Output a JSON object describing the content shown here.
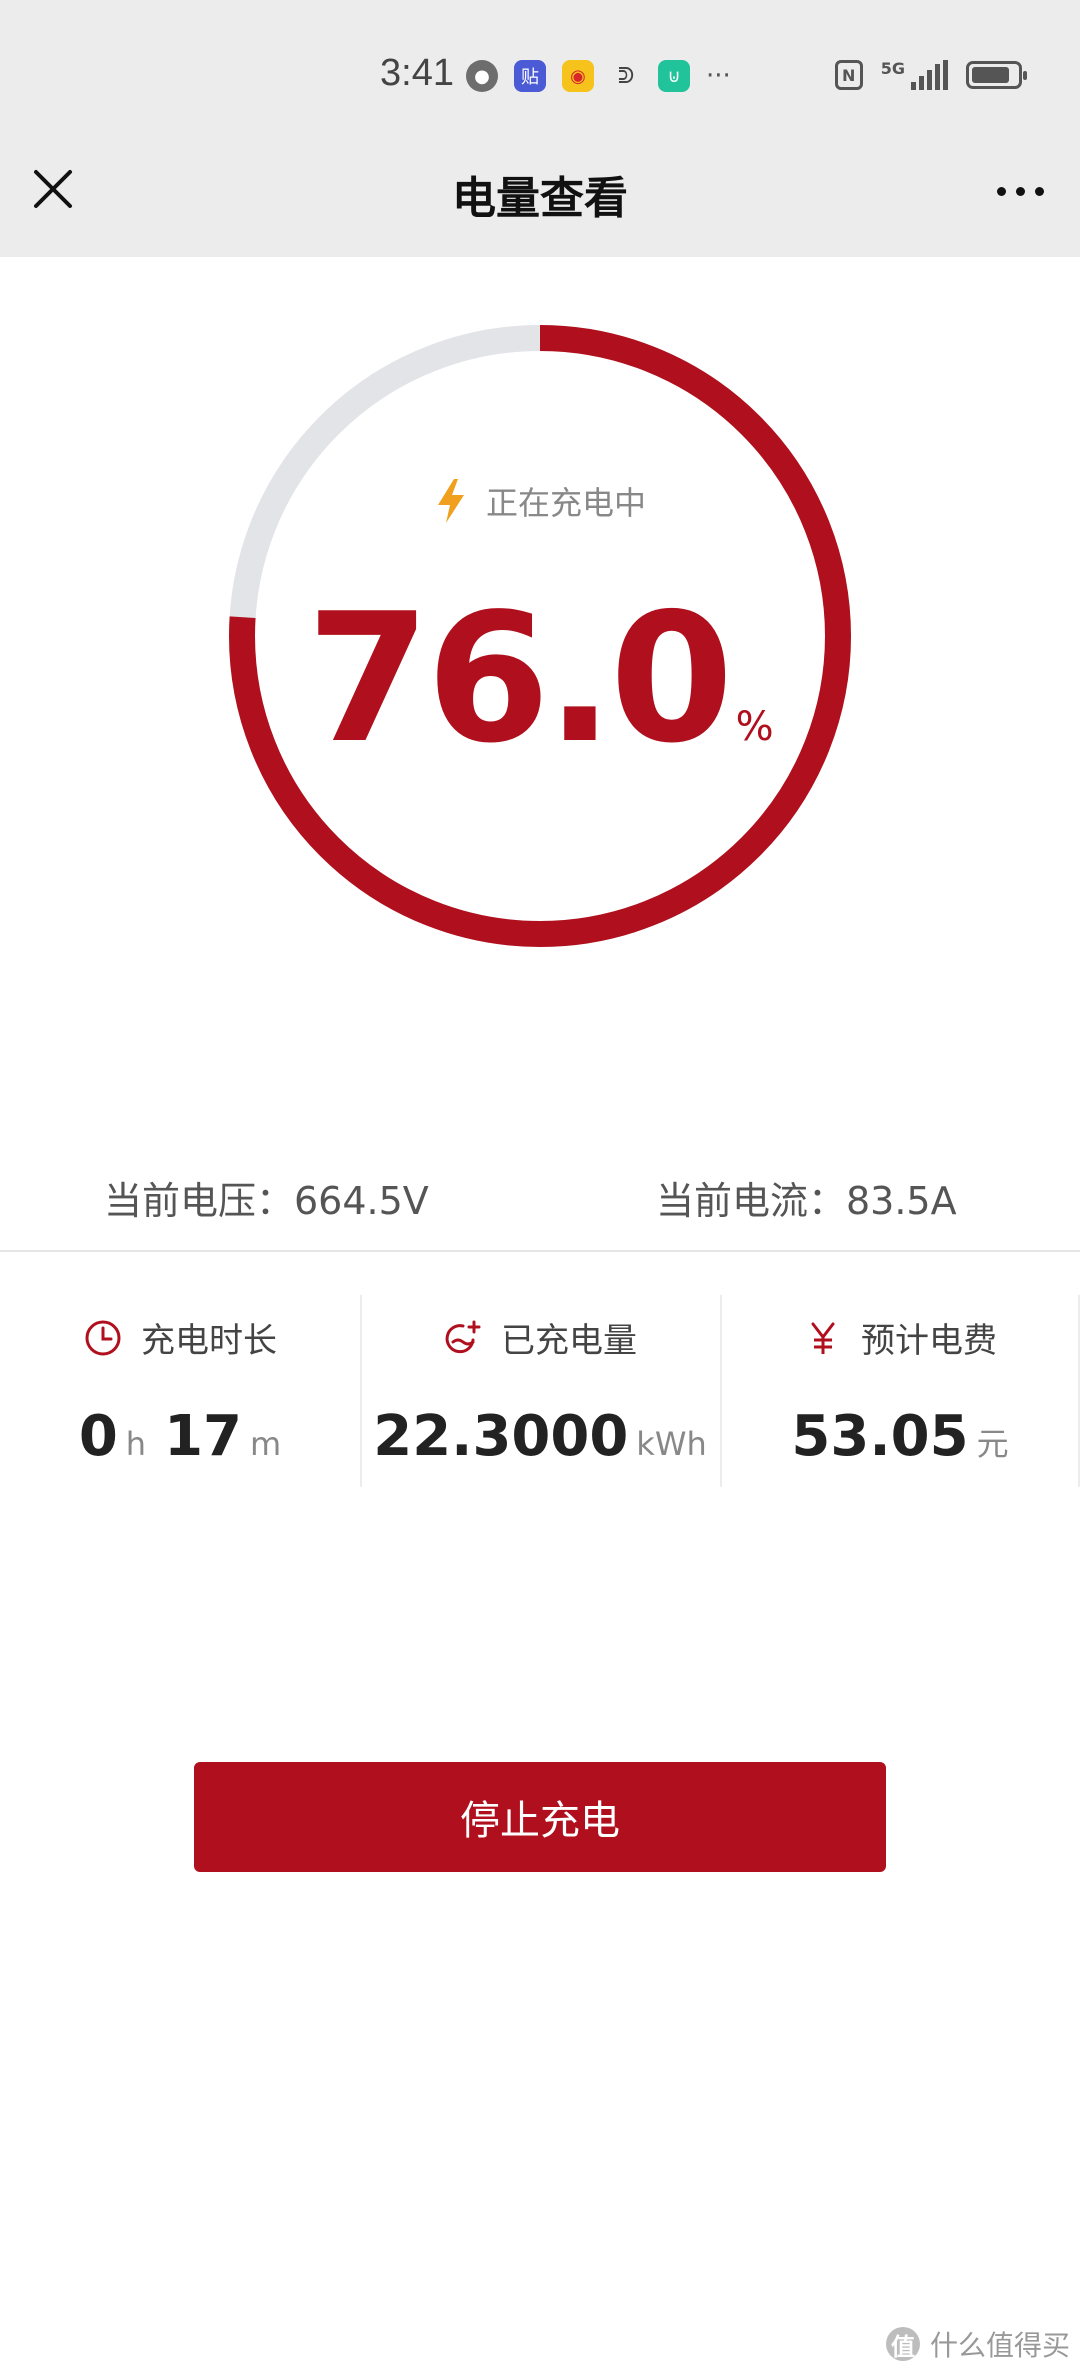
{
  "status_bar": {
    "time": "3:41",
    "notification_icons": [
      "wechat-icon",
      "tieba-icon",
      "weibo-icon",
      "app-icon",
      "mijia-icon"
    ],
    "more_label": "···",
    "network": "5G",
    "right_icons": [
      "nfc-icon",
      "signal-icon",
      "battery-icon"
    ]
  },
  "header": {
    "title": "电量查看",
    "close_icon": "close-icon",
    "more_icon": "more-icon"
  },
  "charge": {
    "status_text": "正在充电中",
    "status_icon": "lightning-icon",
    "percent_value": "76.0",
    "percent_unit": "%",
    "percent": 76.0
  },
  "readings": {
    "voltage": "当前电压：664.5V",
    "current": "当前电流：83.5A"
  },
  "stats": {
    "duration": {
      "label": "充电时长",
      "hours": "0",
      "hours_unit": "h",
      "minutes": "17",
      "minutes_unit": "m",
      "icon": "clock-icon"
    },
    "energy": {
      "label": "已充电量",
      "value": "22.3000",
      "unit": "kWh",
      "icon": "energy-icon"
    },
    "cost": {
      "label": "预计电费",
      "value": "53.05",
      "unit": "元",
      "icon": "yuan-icon"
    }
  },
  "actions": {
    "stop_label": "停止充电"
  },
  "watermark": {
    "text": "什么值得买",
    "badge": "值"
  },
  "colors": {
    "accent": "#b0101d",
    "ring_track": "#e3e4e8",
    "bolt": "#f0a01e",
    "header_bg": "#ececec"
  }
}
